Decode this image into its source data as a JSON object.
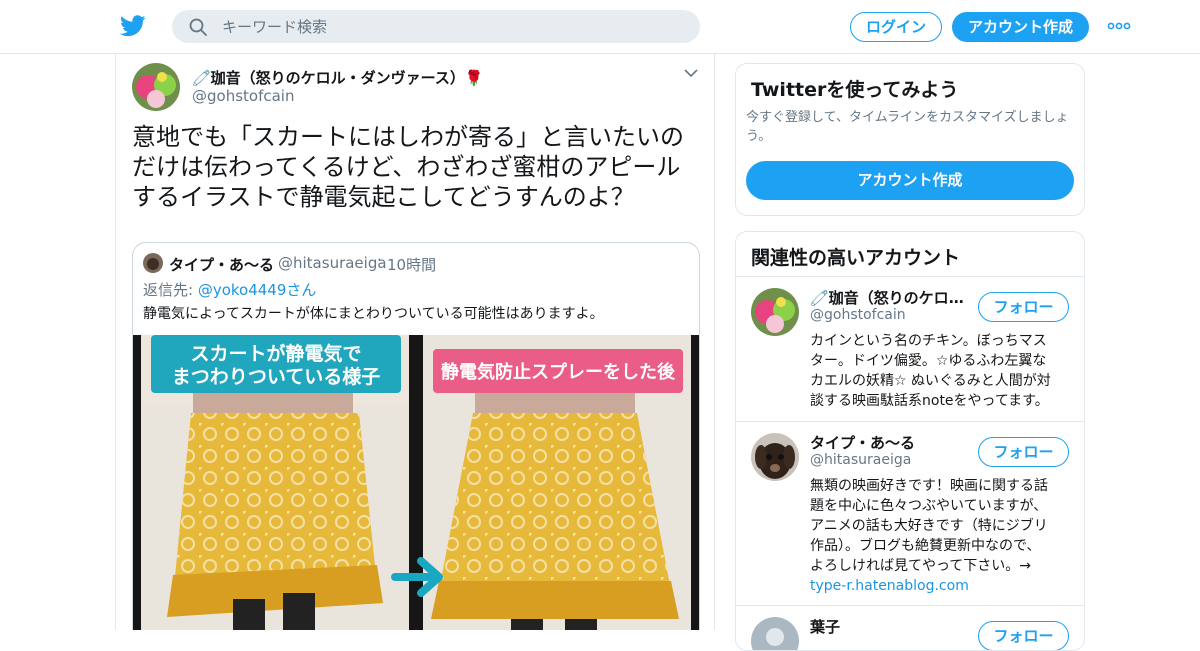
{
  "header": {
    "search_placeholder": "キーワード検索",
    "login_label": "ログイン",
    "signup_label": "アカウント作成",
    "logo_icon": "twitter-bird-icon",
    "accent_color": "#1da1f2"
  },
  "tweet": {
    "author_name": "🧷珈音（怒りのケロル・ダンヴァース）🌹",
    "author_handle": "@gohstofcain",
    "text_lines": [
      "意地でも「スカートにはしわが寄る」と言いたいの",
      "だけは伝わってくるけど、わざわざ蜜柑のアピール",
      "するイラストで静電気起こしてどうすんのよ？"
    ],
    "quote": {
      "author_name": "タイプ・あ～る",
      "author_handle": "@hitasuraeiga",
      "separator": "·",
      "time": "10時間",
      "reply_prefix": "返信先: ",
      "reply_to": "@yoko4449さん",
      "text": "静電気によってスカートが体にまとわりついている可能性はありますよ。",
      "media": {
        "left_caption_line1": "スカートが静電気で",
        "left_caption_line2": "まつわりついている様子",
        "right_caption": "静電気防止スプレーをした後"
      }
    }
  },
  "sidebar": {
    "signup_card": {
      "title": "Twitterを使ってみよう",
      "subtitle": "今すぐ登録して、タイムラインをカスタマイズしましょう。",
      "button_label": "アカウント作成"
    },
    "related": {
      "title": "関連性の高いアカウント",
      "follow_label": "フォロー",
      "accounts": [
        {
          "name": "🧷珈音（怒りのケロル…",
          "handle": "@gohstofcain",
          "bio_lines": [
            "カインという名のチキン。ぼっちマス",
            "ター。ドイツ偏愛。☆ゆるふわ左翼な",
            "カエルの妖精☆ ぬいぐるみと人間が対",
            "談する映画駄話系noteをやってます。"
          ]
        },
        {
          "name": "タイプ・あ～る",
          "handle": "@hitasuraeiga",
          "bio_lines": [
            "無類の映画好きです！映画に関する話",
            "題を中心に色々つぶやいていますが、",
            "アニメの話も大好きです（特にジブリ",
            "作品）。ブログも絶賛更新中なので、",
            "よろしければ見てやって下さい。→"
          ],
          "bio_link": "type-r.hatenablog.com"
        },
        {
          "name": "葉子",
          "handle": ""
        }
      ]
    }
  }
}
